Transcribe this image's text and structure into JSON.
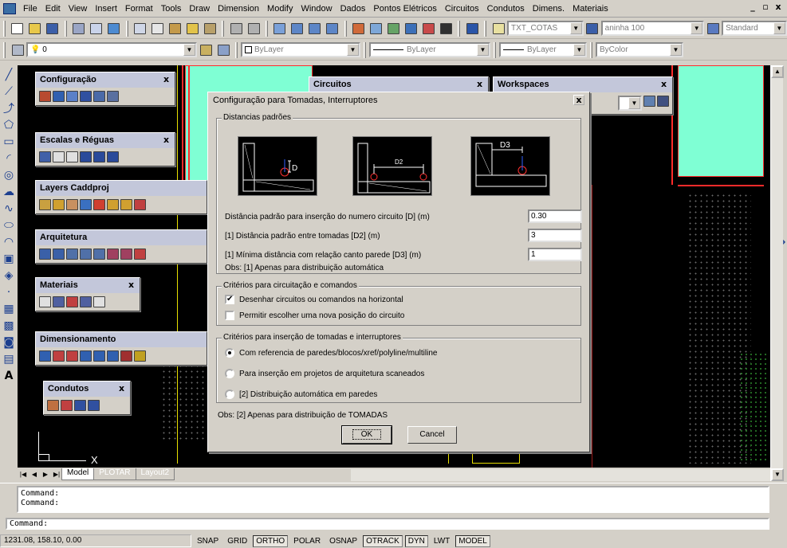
{
  "menu": {
    "items": [
      "File",
      "Edit",
      "View",
      "Insert",
      "Format",
      "Tools",
      "Draw",
      "Dimension",
      "Modify",
      "Window",
      "Dados",
      "Pontos Elétricos",
      "Circuitos",
      "Condutos",
      "Dimens.",
      "Materiais"
    ],
    "window_controls": [
      "_",
      "▫",
      "x"
    ]
  },
  "toolbar": {
    "text_style": "TXT_COTAS",
    "dim_style": "aninha 100",
    "table_style": "Standard",
    "layer": "0",
    "color": "ByLayer",
    "linetype": "ByLayer",
    "lineweight": "ByLayer",
    "plotstyle": "ByColor"
  },
  "floating_toolbars": {
    "configuracao": "Configuração",
    "escalas": "Escalas e Réguas",
    "layers": "Layers Caddproj",
    "arquitetura": "Arquitetura",
    "materiais": "Materiais",
    "dimensionamento": "Dimensionamento",
    "condutos": "Condutos",
    "circuitos": "Circuitos",
    "workspaces": "Workspaces",
    "close": "x"
  },
  "dialog": {
    "title": "Configuração para Tomadas, Interruptores",
    "close": "x",
    "group_distancias": "Distancias padrões",
    "img1_label": "D",
    "img2_label": "D2",
    "img3_label": "D3",
    "field1_label": "Distância padrão para inserção do numero circuito [D] (m)",
    "field1_value": "0.30",
    "field2_label": "[1] Distância padrão entre tomadas [D2] (m)",
    "field2_value": "3",
    "field3_label": "[1] Mínima distância com relação canto parede [D3] (m)",
    "field3_value": "1",
    "obs1": "Obs: [1] Apenas para distribuição automática",
    "group_circuitacao": "Critérios para circuitação e comandos",
    "check1_label": "Desenhar circuitos ou comandos na horizontal",
    "check1_checked": true,
    "check2_label": "Permitir escolher uma nova posição do circuito",
    "check2_checked": false,
    "group_insercao": "Critérios para inserção de tomadas e interruptores",
    "radio1_label": "Com referencia de paredes/blocos/xref/polyline/multiline",
    "radio2_label": "Para inserção em projetos de arquitetura scaneados",
    "radio3_label": "[2] Distribuição automática em paredes",
    "radio_selected": 1,
    "obs2": "Obs: [2] Apenas para distribuição de TOMADAS",
    "ok_label": "OK",
    "cancel_label": "Cancel"
  },
  "canvas": {
    "ucs_x": "X"
  },
  "tabs": {
    "items": [
      "Model",
      "PLOTAR",
      "Layout2"
    ],
    "active": "Model"
  },
  "command": {
    "log": [
      "Command:",
      "Command:"
    ],
    "prompt": "Command:"
  },
  "status": {
    "coords": "1231.08, 158.10, 0.00",
    "buttons": [
      {
        "label": "SNAP",
        "on": false
      },
      {
        "label": "GRID",
        "on": false
      },
      {
        "label": "ORTHO",
        "on": true
      },
      {
        "label": "POLAR",
        "on": false
      },
      {
        "label": "OSNAP",
        "on": false
      },
      {
        "label": "OTRACK",
        "on": true
      },
      {
        "label": "DYN",
        "on": true
      },
      {
        "label": "LWT",
        "on": false
      },
      {
        "label": "MODEL",
        "on": true
      }
    ]
  }
}
